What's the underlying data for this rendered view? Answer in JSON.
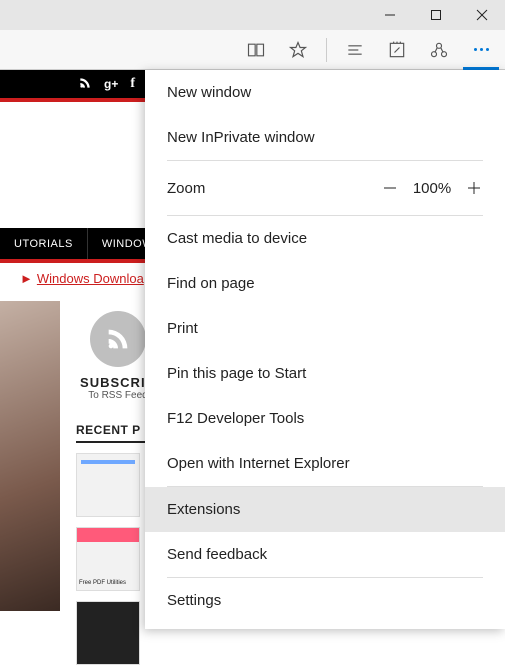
{
  "titlebar": {
    "minimize": "minimize",
    "maximize": "maximize",
    "close": "close"
  },
  "toolbar": {
    "reading": "reading-view",
    "favorite": "favorite",
    "hub": "hub",
    "notes": "web-notes",
    "share": "share",
    "more": "more"
  },
  "page": {
    "social": {
      "rss": "\\e800",
      "gplus": "g+",
      "fb": "f"
    },
    "nav": {
      "tutorials": "UTORIALS",
      "windows": "WINDOWS "
    },
    "crumb_label": "Windows Downloa",
    "subscribe_title": "SUBSCRIB",
    "subscribe_sub": "To RSS Feed",
    "recent_title": "RECENT P",
    "thumb2_caption": "Free PDF Utilities"
  },
  "menu": {
    "new_window": "New window",
    "new_inprivate": "New InPrivate window",
    "zoom_label": "Zoom",
    "zoom_value": "100%",
    "cast": "Cast media to device",
    "find": "Find on page",
    "print": "Print",
    "pin": "Pin this page to Start",
    "devtools": "F12 Developer Tools",
    "open_ie": "Open with Internet Explorer",
    "extensions": "Extensions",
    "feedback": "Send feedback",
    "settings": "Settings"
  }
}
